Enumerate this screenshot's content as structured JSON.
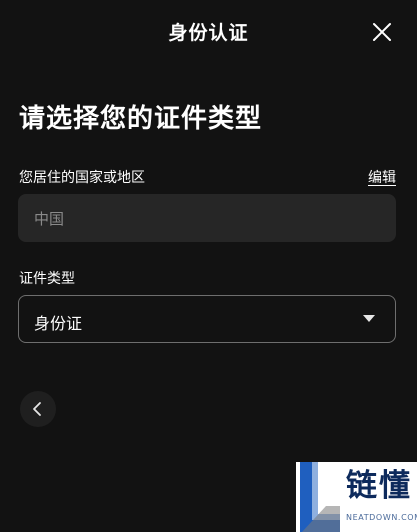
{
  "header": {
    "title": "身份认证"
  },
  "page_title": "请选择您的证件类型",
  "residence": {
    "label": "您居住的国家或地区",
    "edit_label": "编辑",
    "value": "中国"
  },
  "document_type": {
    "label": "证件类型",
    "selected": "身份证"
  },
  "watermark": {
    "brand": "链懂",
    "domain": "NEATDOWN.COM"
  },
  "colors": {
    "background": "#121212",
    "field_bg": "#262626",
    "border": "#6e6e6e"
  },
  "icons": {
    "close": "close-icon",
    "back": "chevron-left-icon",
    "dropdown": "caret-down-icon"
  }
}
